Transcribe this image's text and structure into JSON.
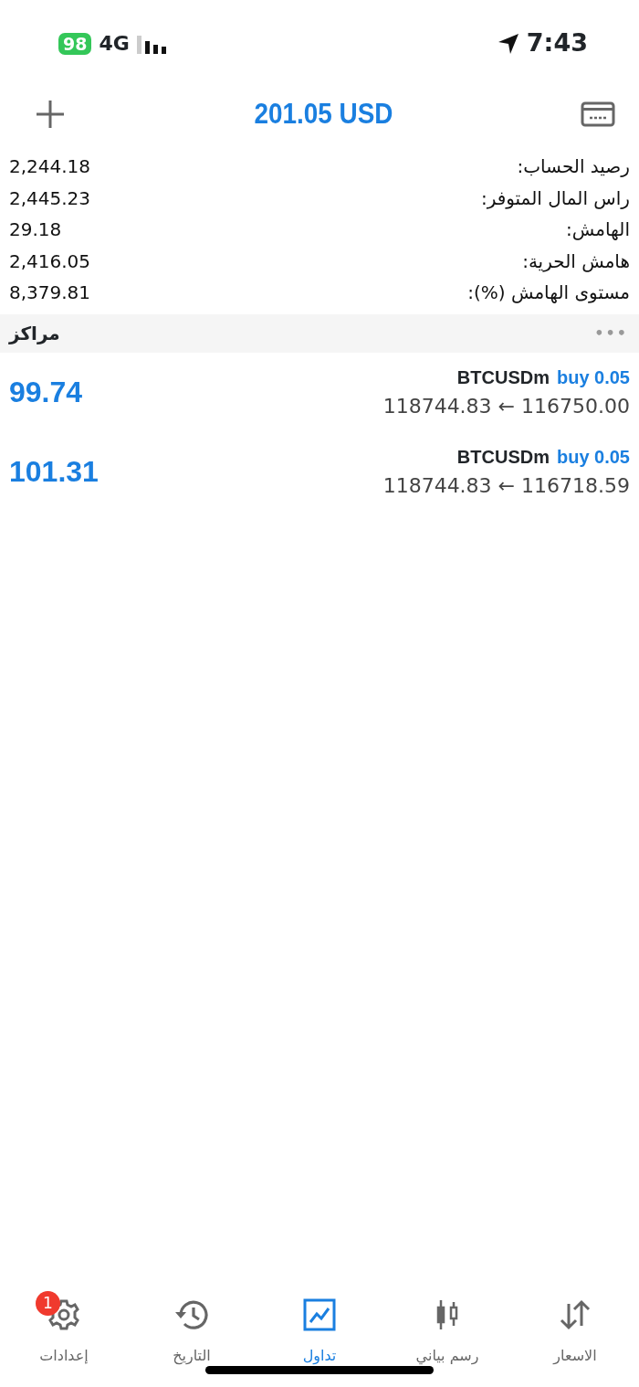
{
  "status_bar": {
    "battery": "98",
    "network": "4G",
    "time": "7:43"
  },
  "header": {
    "title": "201.05 USD"
  },
  "account": [
    {
      "label": "رصيد الحساب:",
      "value": "2,244.18"
    },
    {
      "label": "راس المال المتوفر:",
      "value": "2,445.23"
    },
    {
      "label": "الهامش:",
      "value": "29.18"
    },
    {
      "label": "هامش الحرية:",
      "value": "2,416.05"
    },
    {
      "label": "مستوى الهامش (%):",
      "value": "8,379.81"
    }
  ],
  "positions_header": {
    "title": "مراكز",
    "more": "•••"
  },
  "positions": [
    {
      "symbol": "BTCUSDm",
      "side": "buy 0.05",
      "prices": "118744.83 ← 116750.00",
      "profit": "99.74"
    },
    {
      "symbol": "BTCUSDm",
      "side": "buy 0.05",
      "prices": "118744.83 ← 116718.59",
      "profit": "101.31"
    }
  ],
  "tabs": [
    {
      "kind": "quotes",
      "label": "الاسعار",
      "selected": false
    },
    {
      "kind": "chart",
      "label": "رسم بياني",
      "selected": false
    },
    {
      "kind": "trade",
      "label": "تداول",
      "selected": true
    },
    {
      "kind": "history",
      "label": "التاريخ",
      "selected": false
    },
    {
      "kind": "settings",
      "label": "إعدادات",
      "selected": false,
      "badge": "1"
    }
  ]
}
